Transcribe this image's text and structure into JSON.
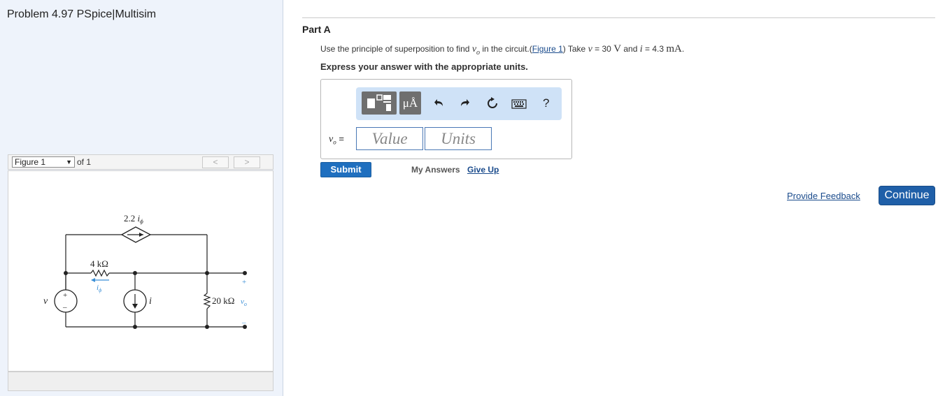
{
  "problem_title": "Problem 4.97 PSpice|Multisim",
  "figure_nav": {
    "selected": "Figure 1",
    "of_text": "of 1",
    "prev": "<",
    "next": ">"
  },
  "circuit": {
    "dep_source_label": "2.2",
    "dep_source_var": "i",
    "dep_source_sub": "ϕ",
    "r1_label": "4 kΩ",
    "current_var": "i",
    "current_sub": "ϕ",
    "source_v": "v",
    "source_i": "i",
    "r2_label": "20 kΩ",
    "out_var": "v",
    "out_sub": "o",
    "plus": "+",
    "minus": "–"
  },
  "part": {
    "label": "Part A",
    "prompt_pre": "Use the principle of superposition to find",
    "prompt_vo": "v",
    "prompt_vo_sub": "o",
    "prompt_mid": "in the circuit.(",
    "figure_link": "Figure 1",
    "prompt_take": ") Take",
    "v_sym": "v",
    "v_eq": "= 30",
    "v_unit": "V",
    "and": "and",
    "i_sym": "i",
    "i_eq": "= 4.3",
    "i_unit": "mA",
    "end": ".",
    "instruction": "Express your answer with the appropriate units."
  },
  "toolbar": {
    "template_icon": "template-icon",
    "units_label": "μÅ",
    "undo_icon": "undo-icon",
    "redo_icon": "redo-icon",
    "reset_icon": "reset-icon",
    "keyboard_icon": "keyboard-icon",
    "help_label": "?"
  },
  "answer": {
    "var": "v",
    "var_sub": "o",
    "eq": "=",
    "value_placeholder": "Value",
    "units_placeholder": "Units"
  },
  "actions": {
    "submit": "Submit",
    "my_answers": "My Answers",
    "give_up": "Give Up",
    "feedback": "Provide Feedback",
    "continue": "Continue"
  }
}
